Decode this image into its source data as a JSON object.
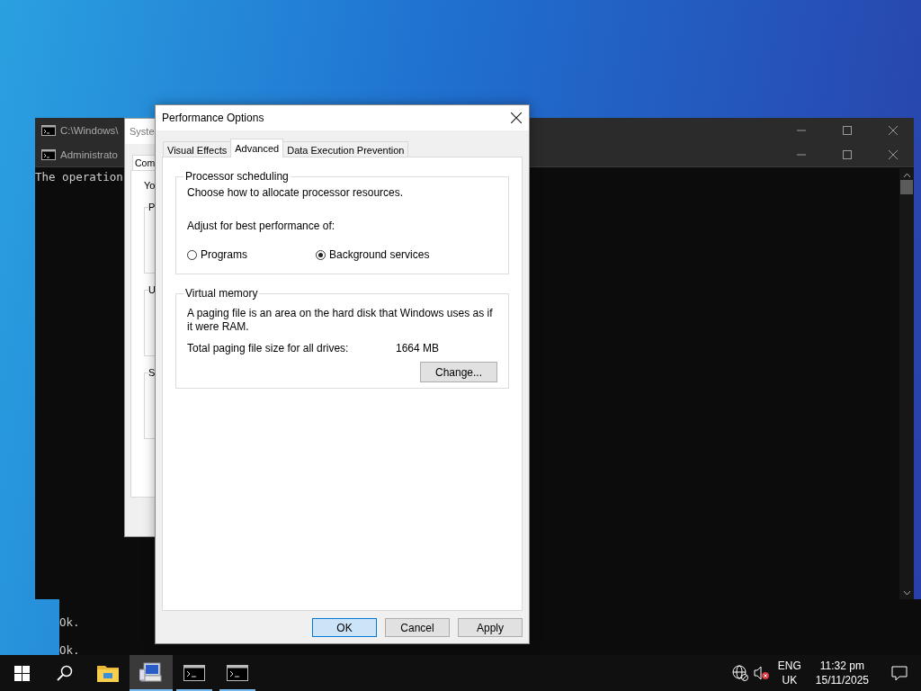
{
  "consoles": [
    {
      "title": "C:\\Windows\\"
    },
    {
      "title": "Administrato",
      "lines": [
        "The operation"
      ]
    }
  ],
  "console_behind": {
    "lines": [
      "Ok.",
      "Ok."
    ]
  },
  "system_properties": {
    "title": "Syste",
    "tab": "Com",
    "text": "Yo",
    "groups": [
      {
        "label": "P"
      },
      {
        "label": "U"
      },
      {
        "label": "S"
      }
    ]
  },
  "dialog": {
    "title": "Performance Options",
    "tabs": [
      {
        "label": "Visual Effects",
        "selected": false
      },
      {
        "label": "Advanced",
        "selected": true
      },
      {
        "label": "Data Execution Prevention",
        "selected": false
      }
    ],
    "processor_scheduling": {
      "title": "Processor scheduling",
      "description": "Choose how to allocate processor resources.",
      "prompt": "Adjust for best performance of:",
      "options": [
        {
          "label": "Programs",
          "selected": false
        },
        {
          "label": "Background services",
          "selected": true
        }
      ]
    },
    "virtual_memory": {
      "title": "Virtual memory",
      "description": "A paging file is an area on the hard disk that Windows uses as if it were RAM.",
      "total_label": "Total paging file size for all drives:",
      "total_value": "1664 MB",
      "button": "Change..."
    },
    "buttons": [
      {
        "label": "OK",
        "default": true
      },
      {
        "label": "Cancel",
        "default": false
      },
      {
        "label": "Apply",
        "default": false
      }
    ]
  },
  "taskbar": {
    "apps": [
      {
        "kind": "folder",
        "running": false,
        "selected": false
      },
      {
        "kind": "system",
        "running": true,
        "selected": true
      },
      {
        "kind": "console",
        "running": true,
        "selected": false
      },
      {
        "kind": "console",
        "running": true,
        "selected": false
      }
    ],
    "tray": {
      "language": "ENG",
      "region": "UK",
      "time": "11:32 pm",
      "date": "15/11/2025"
    }
  }
}
